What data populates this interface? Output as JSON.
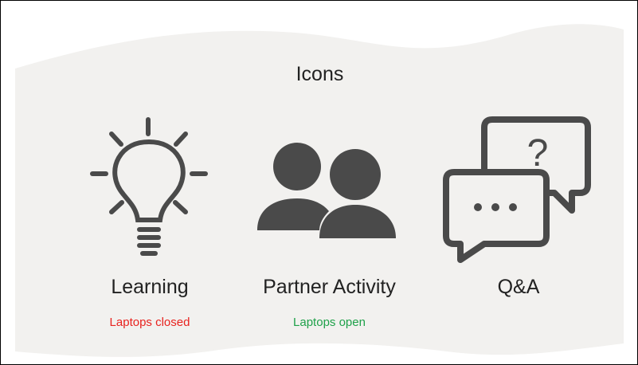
{
  "slide": {
    "title": "Icons",
    "items": [
      {
        "label": "Learning",
        "note": "Laptops closed",
        "icon": "lightbulb-icon",
        "note_color": "#e8231f"
      },
      {
        "label": "Partner Activity",
        "note": "Laptops open",
        "icon": "people-icon",
        "note_color": "#1fa14a"
      },
      {
        "label": "Q&A",
        "icon": "speech-bubbles-icon"
      }
    ]
  },
  "colors": {
    "panel": "#f2f1ef",
    "icon": "#4a4a4a",
    "text": "#222222"
  }
}
